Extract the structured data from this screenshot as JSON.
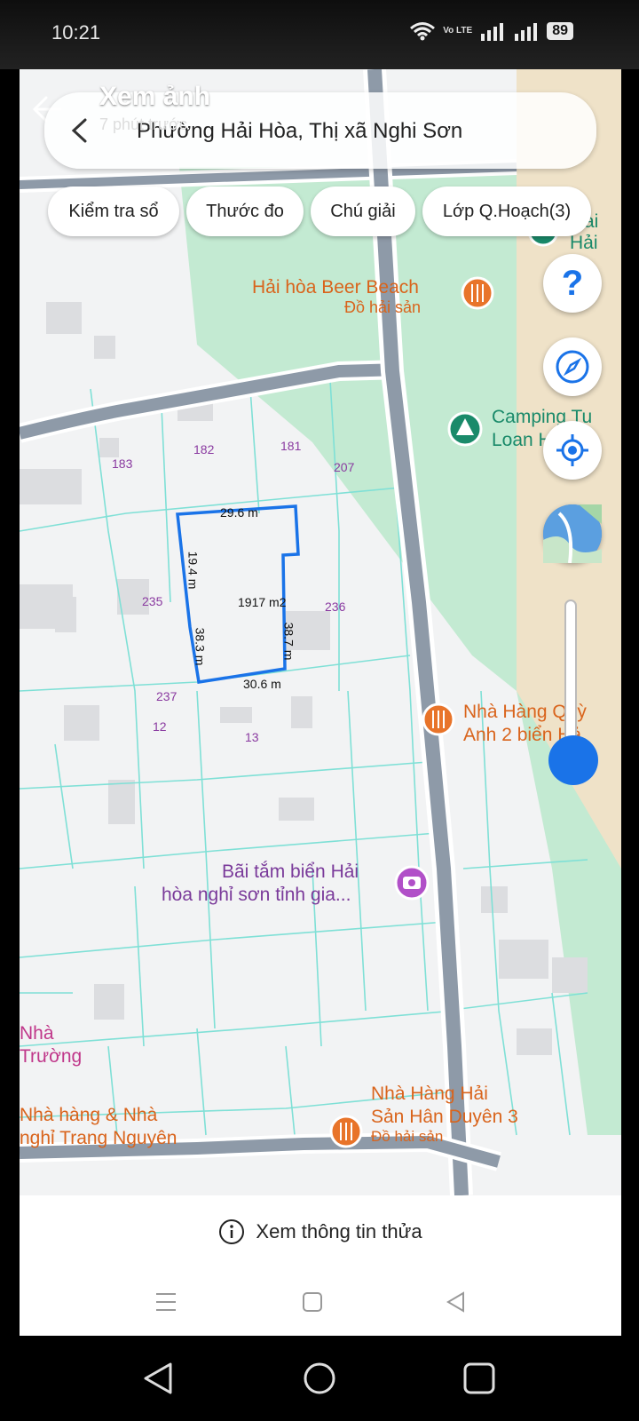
{
  "status": {
    "time": "10:21",
    "network": "Vo LTE",
    "battery": "89"
  },
  "header": {
    "title": "Xem ảnh",
    "subtitle": "7 phút trước"
  },
  "search": {
    "location": "Phường Hải Hòa, Thị xã Nghi Sơn"
  },
  "chips": [
    "Kiểm tra sổ",
    "Thước đo",
    "Chú giải",
    "Lớp Q.Hoạch(3)"
  ],
  "map": {
    "pois": {
      "beer_beach_name": "Hải hòa Beer Beach",
      "beer_beach_cat": "Đồ hải sản",
      "camping_line1": "Camping Tu",
      "camping_line2": "Loan Hồ",
      "hai_label_1": "ai",
      "hai_label_2": "Hải",
      "quynh_line1": "Nhà Hàng Quỳ",
      "quynh_line2": "Anh 2 biển Hả",
      "beach_line1": "Bãi tắm biển Hải",
      "beach_line2": "hòa nghỉ sơn tỉnh gia...",
      "truong_line1": "Nhà",
      "truong_line2": "Trường",
      "trang_line1": "Nhà hàng & Nhà",
      "trang_line2": "nghỉ Trang Nguyên",
      "duyen_line1": "Nhà Hàng Hải",
      "duyen_line2": "Sản Hân Duyên 3",
      "duyen_cat": "Đồ hải sản"
    },
    "parcels": [
      "183",
      "182",
      "181",
      "207",
      "235",
      "236",
      "237",
      "12",
      "13"
    ],
    "selected_parcel": {
      "area": "1917 m2",
      "top": "29.6 m",
      "left": "19.4 m",
      "left_lower": "38.3 m",
      "right": "38.7 m",
      "bottom": "30.6 m"
    }
  },
  "info_button": "Xem thông tin thửa",
  "colors": {
    "accent": "#1a73e8",
    "parcel_line": "#7fe0d6",
    "park": "#bfe8cf",
    "road": "#8e9aa8",
    "poi": "#e8742a"
  }
}
